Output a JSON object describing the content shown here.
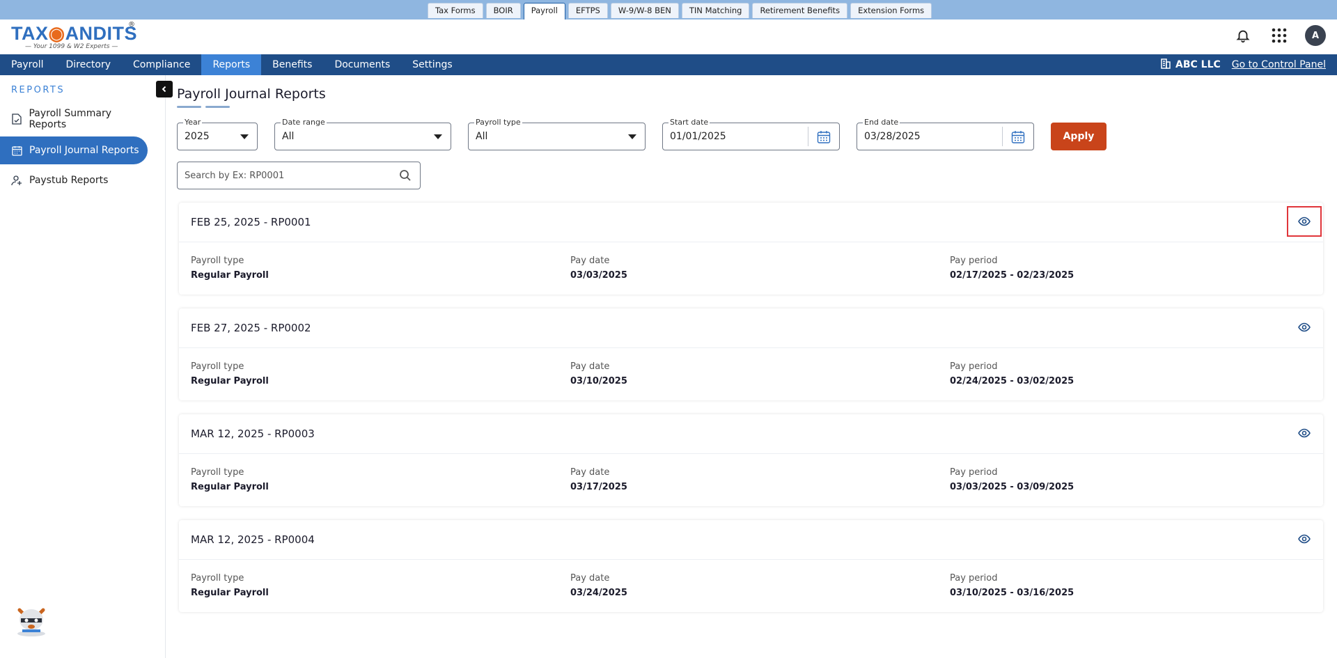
{
  "top_tabs": [
    "Tax Forms",
    "BOIR",
    "Payroll",
    "EFTPS",
    "W-9/W-8 BEN",
    "TIN Matching",
    "Retirement Benefits",
    "Extension Forms"
  ],
  "top_tabs_active": "Payroll",
  "logo": {
    "brand_left": "TAX",
    "brand_right": "ANDITS",
    "registered": "®",
    "tagline": "Your 1099 & W2 Experts"
  },
  "header": {
    "avatar_initial": "A",
    "icons": [
      "bell-icon",
      "apps-grid-icon"
    ]
  },
  "main_nav": {
    "items": [
      "Payroll",
      "Directory",
      "Compliance",
      "Reports",
      "Benefits",
      "Documents",
      "Settings"
    ],
    "active": "Reports",
    "company": "ABC LLC",
    "control_panel_link": "Go to Control Panel"
  },
  "sidebar": {
    "heading": "REPORTS",
    "items": [
      {
        "label": "Payroll Summary Reports",
        "icon": "document-icon",
        "active": false
      },
      {
        "label": "Payroll Journal Reports",
        "icon": "calendar-icon",
        "active": true
      },
      {
        "label": "Paystub Reports",
        "icon": "user-add-icon",
        "active": false
      }
    ]
  },
  "page": {
    "title": "Payroll Journal Reports"
  },
  "filters": {
    "year": {
      "label": "Year",
      "value": "2025"
    },
    "date_range": {
      "label": "Date range",
      "value": "All"
    },
    "payroll_type": {
      "label": "Payroll type",
      "value": "All"
    },
    "start_date": {
      "label": "Start date",
      "value": "01/01/2025"
    },
    "end_date": {
      "label": "End date",
      "value": "03/28/2025"
    },
    "apply_label": "Apply"
  },
  "search": {
    "placeholder": "Search by Ex: RP0001"
  },
  "reports": [
    {
      "title": "FEB 25, 2025 - RP0001",
      "payroll_type_label": "Payroll type",
      "payroll_type": "Regular Payroll",
      "pay_date_label": "Pay date",
      "pay_date": "03/03/2025",
      "pay_period_label": "Pay period",
      "pay_period": "02/17/2025 - 02/23/2025"
    },
    {
      "title": "FEB 27, 2025 - RP0002",
      "payroll_type_label": "Payroll type",
      "payroll_type": "Regular Payroll",
      "pay_date_label": "Pay date",
      "pay_date": "03/10/2025",
      "pay_period_label": "Pay period",
      "pay_period": "02/24/2025 - 03/02/2025"
    },
    {
      "title": "MAR 12, 2025 - RP0003",
      "payroll_type_label": "Payroll type",
      "payroll_type": "Regular Payroll",
      "pay_date_label": "Pay date",
      "pay_date": "03/17/2025",
      "pay_period_label": "Pay period",
      "pay_period": "03/03/2025 - 03/09/2025"
    },
    {
      "title": "MAR 12, 2025 - RP0004",
      "payroll_type_label": "Payroll type",
      "payroll_type": "Regular Payroll",
      "pay_date_label": "Pay date",
      "pay_date": "03/24/2025",
      "pay_period_label": "Pay period",
      "pay_period": "03/10/2025 - 03/16/2025"
    }
  ],
  "colors": {
    "nav_bg": "#1f4d87",
    "nav_active": "#3c82d6",
    "apply_bg": "#c9441a",
    "topbar_bg": "#8fb6e0",
    "highlight_border": "#e0353a"
  }
}
